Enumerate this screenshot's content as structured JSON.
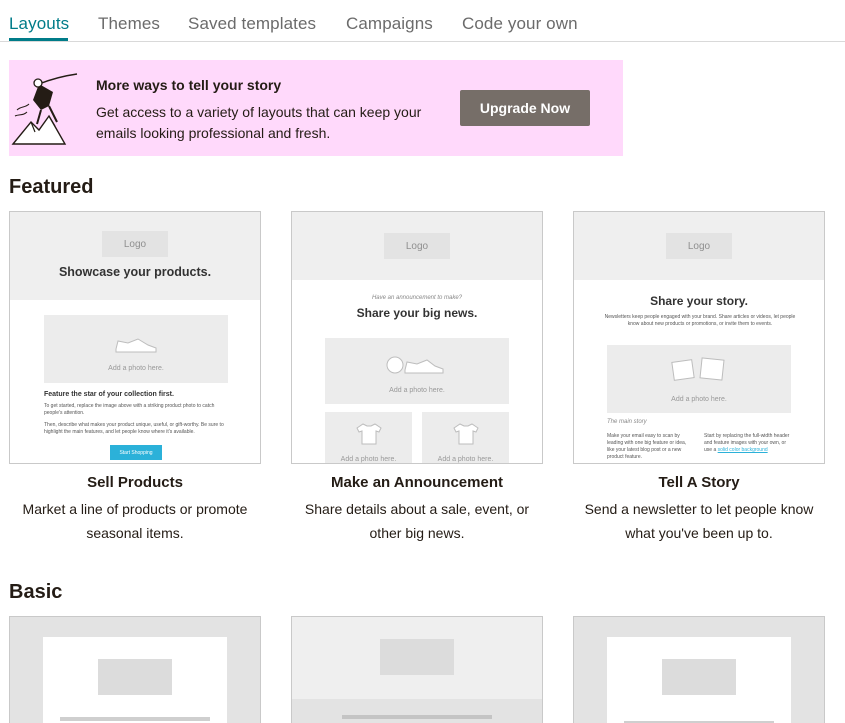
{
  "tabs": {
    "layouts": "Layouts",
    "themes": "Themes",
    "saved_templates": "Saved templates",
    "campaigns": "Campaigns",
    "code_your_own": "Code your own"
  },
  "banner": {
    "title": "More ways to tell your story",
    "text": "Get access to a variety of layouts that can keep your emails looking professional and fresh.",
    "button": "Upgrade Now",
    "background": "#ffd9fb",
    "button_color": "#766e68"
  },
  "sections": {
    "featured": "Featured",
    "basic": "Basic"
  },
  "featured": [
    {
      "name": "Sell Products",
      "desc": "Market a line of products or promote seasonal items.",
      "thumb": {
        "logo": "Logo",
        "heading": "Showcase your products.",
        "photo_label": "Add a photo here.",
        "feature_title": "Feature the star of your collection first.",
        "para1": "To get started, replace the image above with a striking product photo to catch people's attention.",
        "para2": "Then, describe what makes your product unique, useful, or gift-worthy. Be sure to highlight the main features, and let people know where it's available.",
        "button": "Start Shopping"
      }
    },
    {
      "name": "Make an Announcement",
      "desc": "Share details about a sale, event, or other big news.",
      "thumb": {
        "logo": "Logo",
        "kicker": "Have an announcement to make?",
        "heading": "Share your big news.",
        "photo_label": "Add a photo here.",
        "photo_label_left": "Add a photo here.",
        "photo_label_right": "Add a photo here."
      }
    },
    {
      "name": "Tell A Story",
      "desc": "Send a newsletter to let people know what you've been up to.",
      "thumb": {
        "logo": "Logo",
        "heading": "Share your story.",
        "intro": "Newsletters keep people engaged with your brand. Share articles or videos, let people know about new products or promotions, or invite them to events.",
        "photo_label": "Add a photo here.",
        "main_story": "The main story",
        "col_left": "Make your email easy to scan by leading with one big feature or idea, like your latest blog post or a new product feature.",
        "col_right": "Start by replacing the full-width header and feature images with your own, or use a",
        "col_right_link": "solid color background"
      }
    }
  ],
  "accent_color": "#007c89"
}
